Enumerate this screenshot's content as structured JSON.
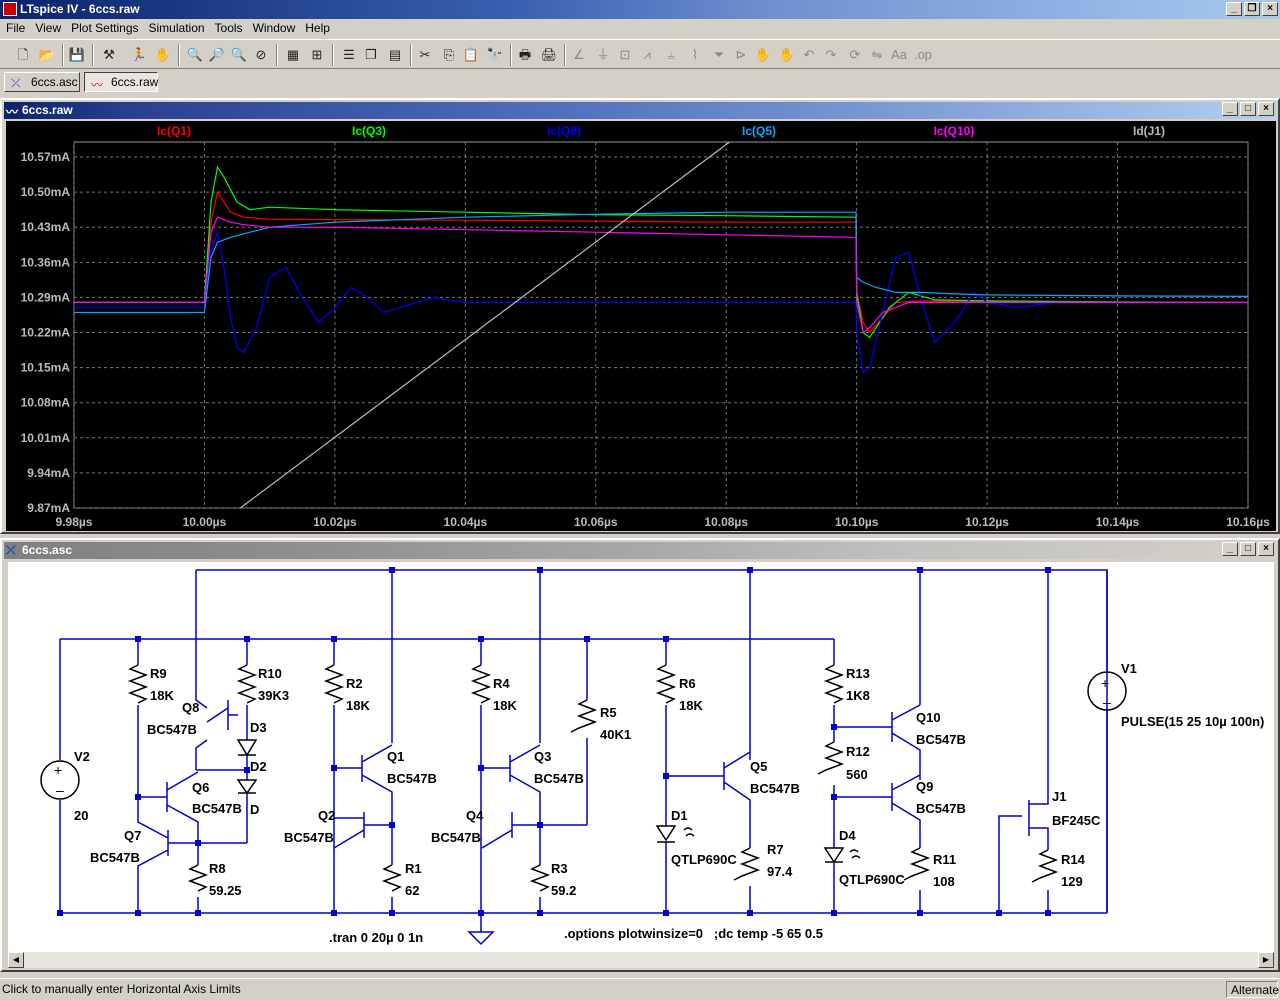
{
  "app": {
    "title": "LTspice IV - 6ccs.raw"
  },
  "menu": [
    "File",
    "View",
    "Plot Settings",
    "Simulation",
    "Tools",
    "Window",
    "Help"
  ],
  "tabs": [
    {
      "label": "6ccs.asc"
    },
    {
      "label": "6ccs.raw"
    }
  ],
  "plot_window": {
    "title": "6ccs.raw"
  },
  "schematic_window": {
    "title": "6ccs.asc"
  },
  "chart_data": {
    "type": "line",
    "title": "",
    "xlabel": "",
    "ylabel": "",
    "xlim": [
      9.98,
      10.16
    ],
    "ylim": [
      9.87,
      10.6
    ],
    "grid": true,
    "legend": "top",
    "x_ticks": [
      "9.98µs",
      "10.00µs",
      "10.02µs",
      "10.04µs",
      "10.06µs",
      "10.08µs",
      "10.10µs",
      "10.12µs",
      "10.14µs",
      "10.16µs"
    ],
    "x_tick_values": [
      9.98,
      10.0,
      10.02,
      10.04,
      10.06,
      10.08,
      10.1,
      10.12,
      10.14,
      10.16
    ],
    "y_ticks": [
      "10.57mA",
      "10.50mA",
      "10.43mA",
      "10.36mA",
      "10.29mA",
      "10.22mA",
      "10.15mA",
      "10.08mA",
      "10.01mA",
      "9.94mA",
      "9.87mA"
    ],
    "y_tick_values": [
      10.57,
      10.5,
      10.43,
      10.36,
      10.29,
      10.22,
      10.15,
      10.08,
      10.01,
      9.94,
      9.87
    ],
    "series": [
      {
        "name": "Ic(Q1)",
        "color": "#ff0000",
        "x": [
          9.98,
          10.0,
          10.001,
          10.002,
          10.004,
          10.006,
          10.01,
          10.02,
          10.04,
          10.06,
          10.08,
          10.0999,
          10.1,
          10.101,
          10.102,
          10.104,
          10.106,
          10.11,
          10.12,
          10.14,
          10.16
        ],
        "y": [
          10.28,
          10.28,
          10.44,
          10.5,
          10.46,
          10.45,
          10.446,
          10.445,
          10.444,
          10.442,
          10.44,
          10.44,
          10.3,
          10.24,
          10.22,
          10.25,
          10.28,
          10.283,
          10.281,
          10.28,
          10.28
        ]
      },
      {
        "name": "Ic(Q3)",
        "color": "#00ff00",
        "x": [
          9.98,
          10.0,
          10.001,
          10.002,
          10.003,
          10.005,
          10.007,
          10.01,
          10.02,
          10.04,
          10.06,
          10.08,
          10.0999,
          10.1,
          10.101,
          10.102,
          10.103,
          10.105,
          10.108,
          10.112,
          10.12,
          10.14,
          10.16
        ],
        "y": [
          10.28,
          10.28,
          10.48,
          10.55,
          10.53,
          10.48,
          10.465,
          10.47,
          10.465,
          10.46,
          10.455,
          10.453,
          10.45,
          10.3,
          10.22,
          10.21,
          10.23,
          10.27,
          10.3,
          10.285,
          10.283,
          10.281,
          10.28
        ]
      },
      {
        "name": "Ic(Q8)",
        "color": "#0000ff",
        "x": [
          9.98,
          10.0,
          10.001,
          10.002,
          10.003,
          10.004,
          10.005,
          10.006,
          10.008,
          10.01,
          10.0125,
          10.015,
          10.0175,
          10.02,
          10.0225,
          10.025,
          10.0275,
          10.03,
          10.035,
          10.04,
          10.05,
          10.06,
          10.08,
          10.0999,
          10.1,
          10.101,
          10.102,
          10.104,
          10.106,
          10.108,
          10.11,
          10.112,
          10.115,
          10.118,
          10.12,
          10.125,
          10.13,
          10.14,
          10.16
        ],
        "y": [
          10.27,
          10.27,
          10.38,
          10.42,
          10.35,
          10.25,
          10.19,
          10.18,
          10.23,
          10.33,
          10.35,
          10.29,
          10.24,
          10.27,
          10.31,
          10.29,
          10.26,
          10.27,
          10.29,
          10.28,
          10.28,
          10.28,
          10.28,
          10.28,
          10.22,
          10.14,
          10.15,
          10.26,
          10.37,
          10.38,
          10.28,
          10.2,
          10.24,
          10.3,
          10.28,
          10.27,
          10.28,
          10.28,
          10.28
        ]
      },
      {
        "name": "Ic(Q5)",
        "color": "#00aaff",
        "x": [
          9.98,
          10.0,
          10.001,
          10.002,
          10.004,
          10.007,
          10.01,
          10.02,
          10.04,
          10.06,
          10.08,
          10.0999,
          10.1,
          10.101,
          10.103,
          10.106,
          10.11,
          10.115,
          10.12,
          10.14,
          10.16
        ],
        "y": [
          10.26,
          10.26,
          10.37,
          10.4,
          10.41,
          10.42,
          10.43,
          10.44,
          10.45,
          10.456,
          10.46,
          10.46,
          10.33,
          10.32,
          10.31,
          10.3,
          10.3,
          10.297,
          10.295,
          10.293,
          10.292
        ]
      },
      {
        "name": "Ic(Q10)",
        "color": "#ff00ff",
        "x": [
          9.98,
          10.0,
          10.001,
          10.002,
          10.004,
          10.006,
          10.01,
          10.02,
          10.04,
          10.06,
          10.08,
          10.0999,
          10.1,
          10.101,
          10.102,
          10.104,
          10.108,
          10.12,
          10.14,
          10.16
        ],
        "y": [
          10.28,
          10.28,
          10.42,
          10.45,
          10.44,
          10.435,
          10.43,
          10.43,
          10.425,
          10.42,
          10.415,
          10.41,
          10.28,
          10.22,
          10.23,
          10.26,
          10.28,
          10.28,
          10.28,
          10.28
        ]
      },
      {
        "name": "Id(J1)",
        "color": "#bbbbbb",
        "x": [
          10.0055,
          10.0805
        ],
        "y": [
          9.87,
          10.6
        ]
      }
    ]
  },
  "schematic": {
    "components": {
      "R9": {
        "name": "R9",
        "value": "18K"
      },
      "R10": {
        "name": "R10",
        "value": "39K3"
      },
      "Q8": {
        "name": "Q8",
        "model": "BC547B"
      },
      "D3": {
        "name": "D3"
      },
      "D2": {
        "name": "D2",
        "extra": "D"
      },
      "Q6": {
        "name": "Q6",
        "model": "BC547B"
      },
      "Q7": {
        "name": "Q7",
        "model": "BC547B"
      },
      "R8": {
        "name": "R8",
        "value": "59.25"
      },
      "V2": {
        "name": "V2",
        "value": "20"
      },
      "R2": {
        "name": "R2",
        "value": "18K"
      },
      "Q1": {
        "name": "Q1",
        "model": "BC547B"
      },
      "Q2": {
        "name": "Q2",
        "model": "BC547B"
      },
      "R1": {
        "name": "R1",
        "value": "62"
      },
      "R4": {
        "name": "R4",
        "value": "18K"
      },
      "Q3": {
        "name": "Q3",
        "model": "BC547B"
      },
      "Q4": {
        "name": "Q4",
        "model": "BC547B"
      },
      "R3": {
        "name": "R3",
        "value": "59.2"
      },
      "R5": {
        "name": "R5",
        "value": "40K1"
      },
      "R6": {
        "name": "R6",
        "value": "18K"
      },
      "Q5": {
        "name": "Q5",
        "model": "BC547B"
      },
      "D1": {
        "name": "D1",
        "model": "QTLP690C"
      },
      "R7": {
        "name": "R7",
        "value": "97.4"
      },
      "R13": {
        "name": "R13",
        "value": "1K8"
      },
      "R12": {
        "name": "R12",
        "value": "560"
      },
      "Q10": {
        "name": "Q10",
        "model": "BC547B"
      },
      "Q9": {
        "name": "Q9",
        "model": "BC547B"
      },
      "D4": {
        "name": "D4",
        "model": "QTLP690C"
      },
      "R11": {
        "name": "R11",
        "value": "108"
      },
      "V1": {
        "name": "V1",
        "value": "PULSE(15 25 10µ 100n)"
      },
      "J1": {
        "name": "J1",
        "model": "BF245C"
      },
      "R14": {
        "name": "R14",
        "value": "129"
      }
    },
    "directives": {
      "tran": ".tran 0 20µ 0 1n",
      "options": ".options plotwinsize=0   ;dc temp -5 65 0.5"
    }
  },
  "status": {
    "text": "Click to manually enter Horizontal Axis Limits",
    "mode": "Alternate"
  }
}
